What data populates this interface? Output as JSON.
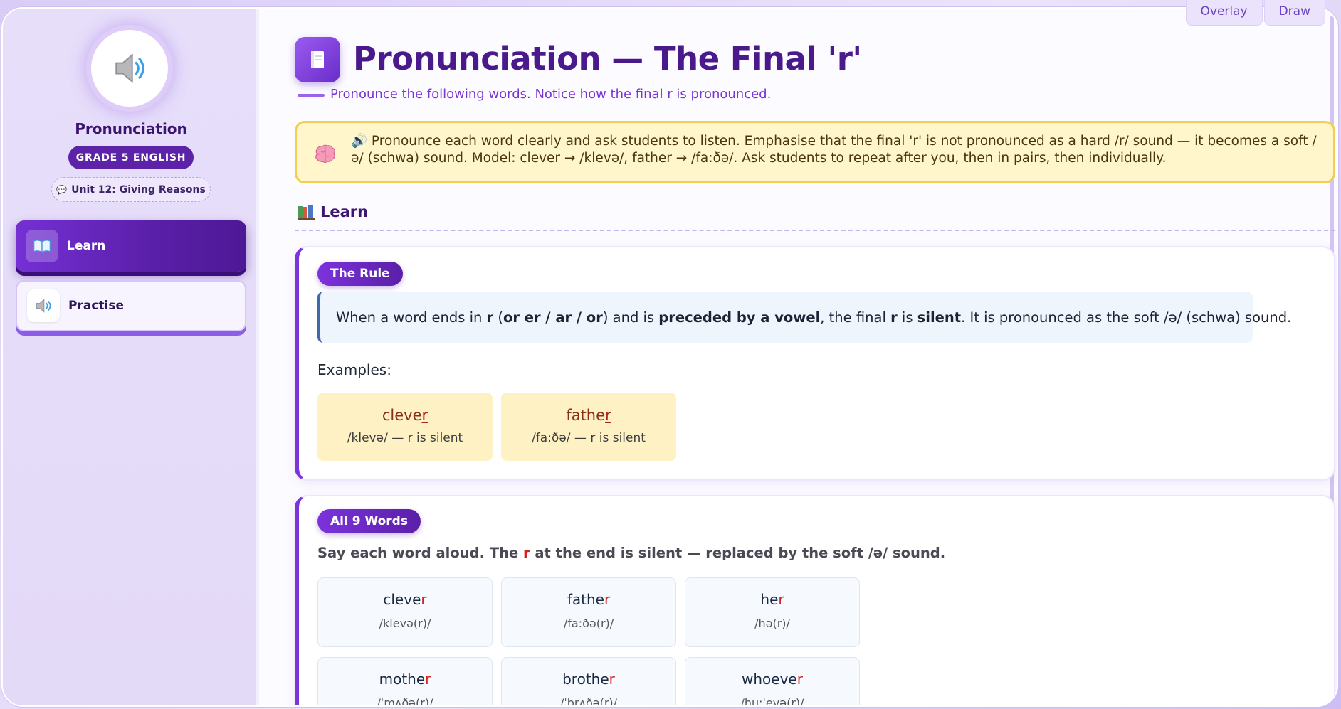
{
  "top_tools": {
    "overlay": "Overlay",
    "draw": "Draw"
  },
  "sidebar": {
    "title": "Pronunciation",
    "grade": "GRADE 5 ENGLISH",
    "unit": "Unit 12: Giving Reasons",
    "unit_icon": "speech-bubble-icon",
    "avatar_icon": "speaker-icon",
    "nav": [
      {
        "label": "Learn",
        "icon": "open-book-icon",
        "active": true
      },
      {
        "label": "Practise",
        "icon": "speaker-icon",
        "active": false
      }
    ]
  },
  "header": {
    "title": "Pronunciation — The Final 'r'",
    "subtitle": "Pronounce the following words. Notice how the final r is pronounced.",
    "icon": "book-icon"
  },
  "teacher_note": {
    "icon": "brain-icon",
    "text": "🔊 Pronounce each word clearly and ask students to listen. Emphasise that the final 'r' is not pronounced as a hard /r/ sound — it becomes a soft /ə/ (schwa) sound. Model: clever → /klevə/, father → /fa:ðə/. Ask students to repeat after you, then in pairs, then individually."
  },
  "learn_section": {
    "label": "Learn",
    "icon": "books-icon"
  },
  "rule_card": {
    "badge": "The Rule",
    "rule": {
      "p1": "When a word ends in ",
      "b1": "r",
      "p2": " (",
      "b2": "or er / ar / or",
      "p3": ") and is ",
      "b3": "preceded by a vowel",
      "p4": ", the final ",
      "b4": "r",
      "p5": " is ",
      "b5": "silent",
      "p6": ". It is pronounced as the soft /ə/ (schwa) sound."
    },
    "examples_label": "Examples:",
    "examples": [
      {
        "stem": "clever",
        "stem_base": "cleve",
        "end": "r",
        "ipa": "/klevə/ — r is silent"
      },
      {
        "stem": "father",
        "stem_base": "fathe",
        "end": "r",
        "ipa": "/fa:ðə/ — r is silent"
      }
    ]
  },
  "words_card": {
    "badge": "All 9 Words",
    "intro_a": "Say each word aloud. The ",
    "intro_r": "r",
    "intro_b": " at the end is silent — replaced by the soft /ə/ sound.",
    "words": [
      {
        "base": "cleve",
        "end": "r",
        "ipa": "/klevə(r)/"
      },
      {
        "base": "fathe",
        "end": "r",
        "ipa": "/fa:ðə(r)/"
      },
      {
        "base": "he",
        "end": "r",
        "ipa": "/hə(r)/"
      },
      {
        "base": "mothe",
        "end": "r",
        "ipa": "/ˈmʌðə(r)/"
      },
      {
        "base": "brothe",
        "end": "r",
        "ipa": "/ˈbrʌðə(r)/"
      },
      {
        "base": "whoeve",
        "end": "r",
        "ipa": "/hu:ˈevə(r)/"
      }
    ]
  },
  "colors": {
    "accent": "#7b34dd",
    "note_bg": "#fff6cc",
    "silent_r": "#d62020"
  }
}
